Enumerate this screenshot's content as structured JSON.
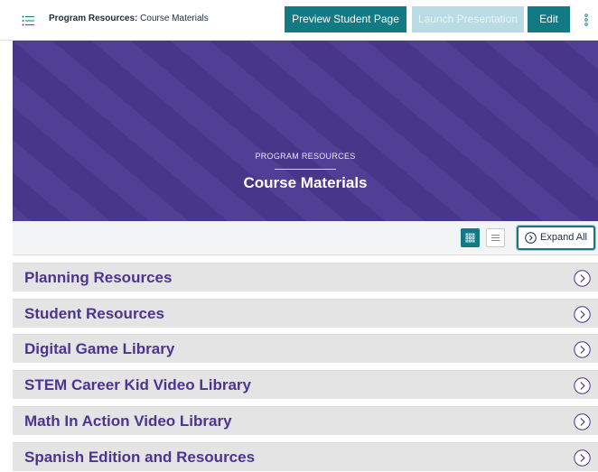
{
  "header": {
    "breadcrumb_strong": "Program Resources:",
    "breadcrumb_rest": "Course Materials",
    "preview_label": "Preview Student Page",
    "launch_label": "Launch Presentation",
    "edit_label": "Edit",
    "icons": {
      "menu": "list-icon",
      "more": "more-vertical-icon"
    }
  },
  "banner": {
    "eyebrow": "PROGRAM RESOURCES",
    "title": "Course Materials",
    "color": "#4b3a8f"
  },
  "toolbar": {
    "expand_label": "Expand All",
    "selected_view": "grid",
    "icons": {
      "grid": "grid-icon",
      "list": "list-view-icon",
      "expand": "chevron-circle-icon"
    }
  },
  "sections": [
    {
      "title": "Planning Resources"
    },
    {
      "title": "Student Resources"
    },
    {
      "title": "Digital Game Library"
    },
    {
      "title": "STEM Career Kid Video Library"
    },
    {
      "title": "Math In Action Video Library"
    },
    {
      "title": "Spanish Edition and Resources"
    }
  ],
  "colors": {
    "accent": "#127a85",
    "banner": "#4b3a8f",
    "section_title": "#4b3590",
    "launch_disabled": "#b8dbe4"
  }
}
